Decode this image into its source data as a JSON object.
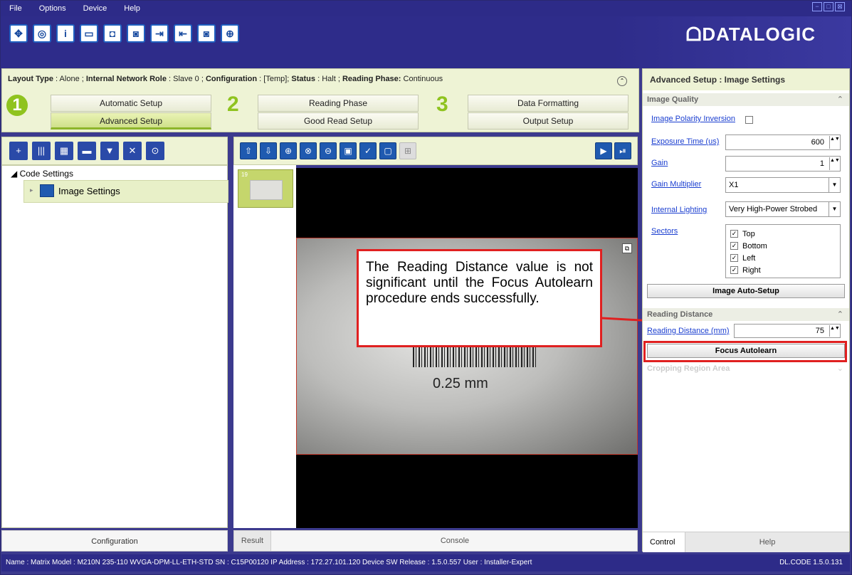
{
  "menu": [
    "File",
    "Options",
    "Device",
    "Help"
  ],
  "window_controls": [
    "−",
    "□",
    "⊠"
  ],
  "toolbar_icons": [
    "connect-icon",
    "device-icon",
    "info-icon",
    "window-icon",
    "camera-icon",
    "camera-settings-icon",
    "export-icon",
    "import-icon",
    "capture-icon",
    "statistics-icon"
  ],
  "toolbar_glyphs": [
    "✥",
    "◎",
    "i",
    "▭",
    "◘",
    "◙",
    "⇥",
    "⇤",
    "◙",
    "⊕"
  ],
  "brand": "ᗝDATALOGIC",
  "info": {
    "layout_type_label": "Layout Type",
    "layout_type": "Alone",
    "role_label": "Internal Network Role",
    "role": "Slave 0",
    "config_label": "Configuration",
    "config": "[Temp]",
    "status_label": "Status",
    "status": "Halt",
    "phase_label": "Reading Phase:",
    "phase": "Continuous",
    "collapse_glyph": "⌃"
  },
  "steps": [
    {
      "num": "1",
      "top": "Automatic Setup",
      "bottom": "Advanced Setup"
    },
    {
      "num": "2",
      "top": "Reading Phase",
      "bottom": "Good Read Setup"
    },
    {
      "num": "3",
      "top": "Data Formatting",
      "bottom": "Output Setup"
    }
  ],
  "left_tools": [
    "+",
    "|||",
    "▦",
    "▬",
    "▼",
    "✕",
    "⊙"
  ],
  "tree": {
    "root": "◢ Code Settings",
    "item_expander": "▸",
    "item": "Image Settings"
  },
  "left_footer": "Configuration",
  "viewer_tools": [
    "⇧",
    "⇩",
    "⊕",
    "⊗",
    "⊖",
    "▣",
    "✓",
    "▢",
    "⊞"
  ],
  "viewer_play": [
    "▶",
    "⏯"
  ],
  "thumb": {
    "number": "19"
  },
  "image_text": "0.25 mm",
  "frame_glyph": "⧉",
  "callout": "The Reading Distance value is not significant until the Focus Autolearn procedure ends successfully.",
  "mid_footer": {
    "result": "Result",
    "console": "Console"
  },
  "right": {
    "header": "Advanced Setup : Image Settings",
    "expand_glyph": "⌃",
    "collapse_glyph": "⌄",
    "spin_glyph": "▲▼",
    "dropdown_glyph": "▼",
    "check_glyph": "✓",
    "image_quality": "Image Quality",
    "polarity": "Image Polarity Inversion",
    "exposure_label": "Exposure Time (us)",
    "exposure": "600",
    "gain_label": "Gain",
    "gain": "1",
    "gain_mult_label": "Gain Multiplier",
    "gain_mult": "X1",
    "lighting_label": "Internal Lighting",
    "lighting": "Very High-Power Strobed",
    "sectors_label": "Sectors",
    "sectors": [
      "Top",
      "Bottom",
      "Left",
      "Right"
    ],
    "auto_setup": "Image Auto-Setup",
    "reading_distance": "Reading Distance",
    "rd_label": "Reading Distance (mm)",
    "rd_value": "75",
    "focus_btn": "Focus Autolearn",
    "cropping": "Cropping Region Area",
    "tab_control": "Control",
    "tab_help": "Help"
  },
  "status": {
    "text": "Name : Matrix  Model : M210N 235-110 WVGA-DPM-LL-ETH-STD   SN : C15P00120   IP Address : 172.27.101.120   Device SW Release : 1.5.0.557   User : Installer-Expert",
    "version": "DL.CODE 1.5.0.131"
  }
}
